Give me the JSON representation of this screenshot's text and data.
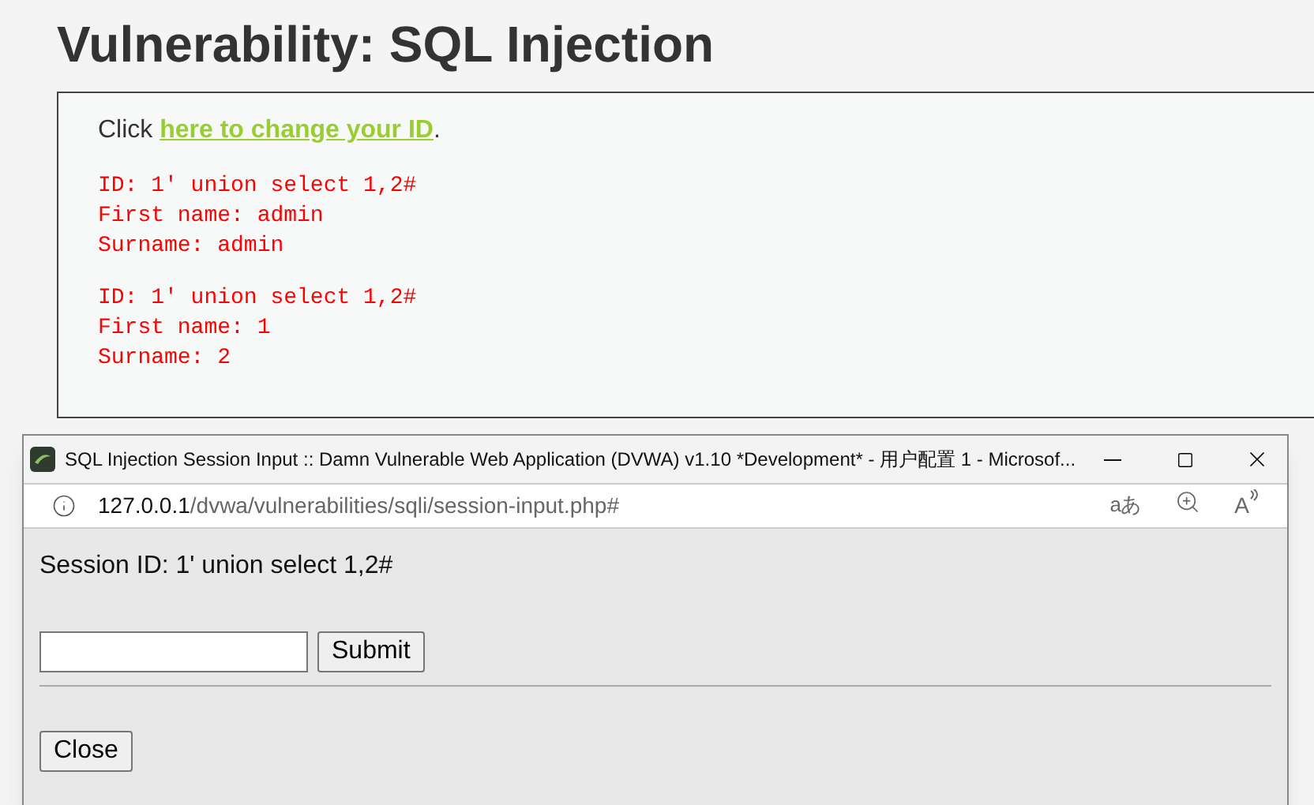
{
  "page": {
    "title": "Vulnerability: SQL Injection",
    "intro": {
      "prefix": "Click ",
      "link": "here to change your ID",
      "suffix": "."
    },
    "results": [
      {
        "lines": [
          "ID: 1' union select 1,2#",
          "First name: admin",
          "Surname: admin"
        ]
      },
      {
        "lines": [
          "ID: 1' union select 1,2#",
          "First name: 1",
          "Surname: 2"
        ]
      }
    ]
  },
  "popup": {
    "title": "SQL Injection Session Input :: Damn Vulnerable Web Application (DVWA) v1.10 *Development* - 用户配置 1 - Microsof...",
    "address": {
      "host": "127.0.0.1",
      "path": "/dvwa/vulnerabilities/sqli/session-input.php#"
    },
    "toolbar": {
      "translate": "aあ",
      "read_aloud": "A"
    },
    "session_text": "Session ID: 1' union select 1,2#",
    "submit": "Submit",
    "close": "Close"
  }
}
